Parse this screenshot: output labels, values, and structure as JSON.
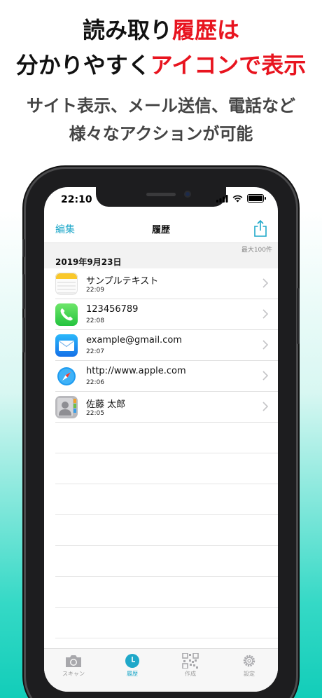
{
  "promo": {
    "line1": "読み取り",
    "line1_red": "履歴は",
    "line2": "分かりやすく",
    "line2_red": "アイコンで表示",
    "sub1": "サイト表示、メール送信、電話など",
    "sub2": "様々なアクションが可能"
  },
  "status": {
    "time": "22:10"
  },
  "navbar": {
    "edit": "編集",
    "title": "履歴",
    "share_icon": "share-icon"
  },
  "limit": "最大100件",
  "section_date": "2019年9月23日",
  "history": [
    {
      "icon": "notes-icon",
      "title": "サンプルテキスト",
      "time": "22:09"
    },
    {
      "icon": "phone-icon",
      "title": "123456789",
      "time": "22:08"
    },
    {
      "icon": "mail-icon",
      "title": "example@gmail.com",
      "time": "22:07"
    },
    {
      "icon": "safari-icon",
      "title": "http://www.apple.com",
      "time": "22:06"
    },
    {
      "icon": "contacts-icon",
      "title": "佐藤 太郎",
      "time": "22:05"
    }
  ],
  "tabs": [
    {
      "icon": "camera-icon",
      "label": "スキャン"
    },
    {
      "icon": "clock-icon",
      "label": "履歴"
    },
    {
      "icon": "qr-code-icon",
      "label": "作成"
    },
    {
      "icon": "gear-icon",
      "label": "設定"
    }
  ],
  "colors": {
    "accent": "#1fa8c9",
    "red": "#e8141f",
    "teal": "#12cdb9"
  }
}
